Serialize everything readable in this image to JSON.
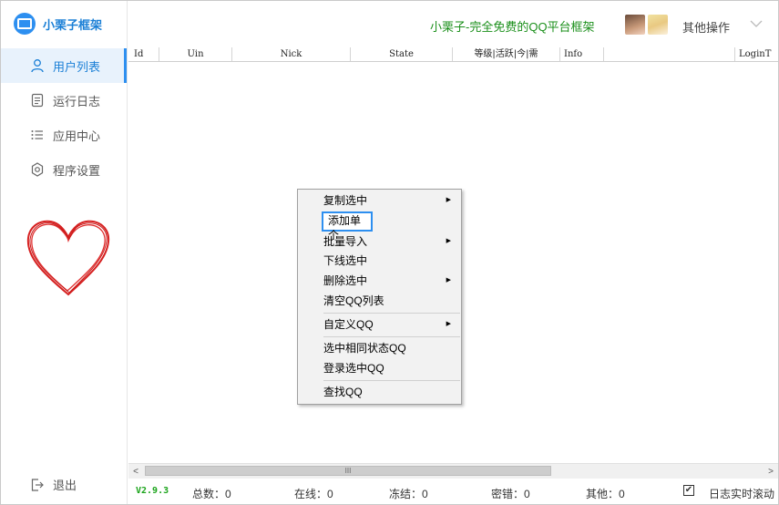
{
  "app": {
    "name": "小栗子框架",
    "header_title": "小栗子-完全免费的QQ平台框架",
    "other_ops": "其他操作"
  },
  "sidebar": {
    "items": [
      {
        "label": "用户列表",
        "icon": "user-icon",
        "active": true
      },
      {
        "label": "运行日志",
        "icon": "document-icon",
        "active": false
      },
      {
        "label": "应用中心",
        "icon": "list-icon",
        "active": false
      },
      {
        "label": "程序设置",
        "icon": "gear-icon",
        "active": false
      }
    ],
    "logout": "退出"
  },
  "table": {
    "columns": [
      "Id",
      "Uin",
      "Nick",
      "State",
      "等级|活跃|今|需",
      "Info",
      "LoginT"
    ]
  },
  "context_menu": {
    "items": [
      {
        "label": "复制选中",
        "submenu": true
      },
      {
        "label": "添加单个",
        "submenu": false
      },
      {
        "label": "批量导入",
        "submenu": true
      },
      {
        "label": "下线选中",
        "submenu": false
      },
      {
        "label": "删除选中",
        "submenu": true
      },
      {
        "label": "清空QQ列表",
        "submenu": false
      },
      {
        "label": "自定义QQ",
        "submenu": true
      },
      {
        "label": "选中相同状态QQ",
        "submenu": false
      },
      {
        "label": "登录选中QQ",
        "submenu": false
      },
      {
        "label": "查找QQ",
        "submenu": false
      }
    ],
    "submenu_arrow": "▶"
  },
  "status": {
    "version": "V2.9.3",
    "total": "总数：0",
    "online": "在线：0",
    "frozen": "冻结：0",
    "wrong_pwd": "密错：0",
    "other": "其他：0",
    "log_scroll": "日志实时滚动",
    "log_scroll_checked": true
  },
  "scroll": {
    "left_arrow": "<",
    "right_arrow": ">",
    "thumb_grip": "III"
  },
  "colors": {
    "accent": "#2d8ff0",
    "title_green": "#1a8f1a",
    "heart": "#d62020"
  }
}
